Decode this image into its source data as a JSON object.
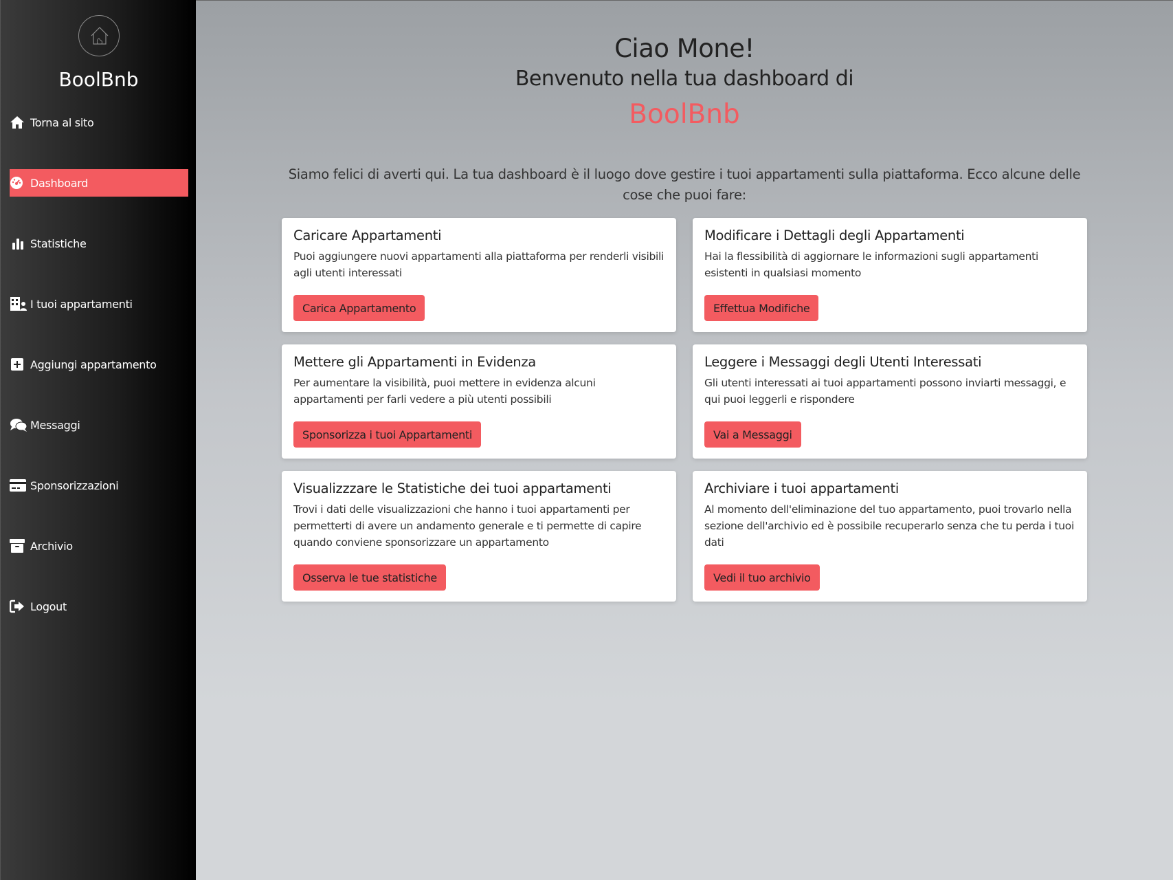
{
  "sidebar": {
    "brand": "BoolBnb",
    "items": [
      {
        "label": "Torna al sito",
        "icon": "home-icon"
      },
      {
        "label": "Dashboard",
        "icon": "gauge-icon",
        "active": true
      },
      {
        "label": "Statistiche",
        "icon": "bar-chart-icon"
      },
      {
        "label": "I tuoi appartamenti",
        "icon": "building-user-icon"
      },
      {
        "label": "Aggiungi appartamento",
        "icon": "plus-square-icon"
      },
      {
        "label": "Messaggi",
        "icon": "comments-icon"
      },
      {
        "label": "Sponsorizzazioni",
        "icon": "credit-card-icon"
      },
      {
        "label": "Archivio",
        "icon": "archive-box-icon"
      },
      {
        "label": "Logout",
        "icon": "logout-icon"
      }
    ]
  },
  "main": {
    "greeting": "Ciao Mone!",
    "welcome": "Benvenuto nella tua dashboard di",
    "brand": "BoolBnb",
    "intro": "Siamo felici di averti qui. La tua dashboard è il luogo dove gestire i tuoi appartamenti sulla piattaforma. Ecco alcune delle cose che puoi fare:",
    "cards": [
      {
        "title": "Caricare Appartamenti",
        "text": "Puoi aggiungere nuovi appartamenti alla piattaforma per renderli visibili agli utenti interessati",
        "button": "Carica Appartamento"
      },
      {
        "title": "Modificare i Dettagli degli Appartamenti",
        "text": "Hai la flessibilità di aggiornare le informazioni sugli appartamenti esistenti in qualsiasi momento",
        "button": "Effettua Modifiche"
      },
      {
        "title": "Mettere gli Appartamenti in Evidenza",
        "text": "Per aumentare la visibilità, puoi mettere in evidenza alcuni appartamenti per farli vedere a più utenti possibili",
        "button": "Sponsorizza i tuoi Appartamenti"
      },
      {
        "title": "Leggere i Messaggi degli Utenti Interessati",
        "text": "Gli utenti interessati ai tuoi appartamenti possono inviarti messaggi, e qui puoi leggerli e rispondere",
        "button": "Vai a Messaggi"
      },
      {
        "title": "Visualizzzare le Statistiche dei tuoi appartamenti",
        "text": "Trovi i dati delle visualizzazioni che hanno i tuoi appartamenti per permetterti di avere un andamento generale e ti permette di capire quando conviene sponsorizzare un appartamento",
        "button": "Osserva le tue statistiche"
      },
      {
        "title": "Archiviare i tuoi appartamenti",
        "text": "Al momento dell'eliminazione del tuo appartamento, puoi trovarlo nella sezione dell'archivio ed è possibile recuperarlo senza che tu perda i tuoi dati",
        "button": "Vedi il tuo archivio"
      }
    ]
  },
  "colors": {
    "accent": "#f35b60",
    "sidebar": "#1c1c1c"
  }
}
